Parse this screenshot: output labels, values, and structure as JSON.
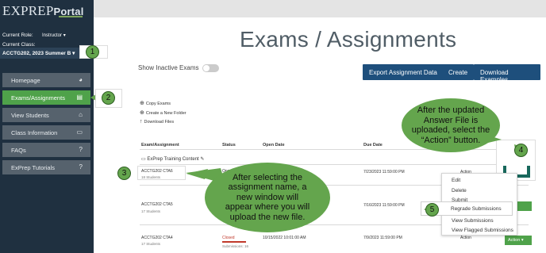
{
  "app": {
    "logo_main": "EXPREP",
    "logo_portal": "Portal"
  },
  "sidebar": {
    "role_label": "Current Role:",
    "role_value": "Instructor",
    "class_label": "Current Class:",
    "class_value": "ACCTG202, 2023 Summer B",
    "items": [
      {
        "label": "Homepage",
        "icon": "dashboard-icon"
      },
      {
        "label": "Exams/Assignments",
        "icon": "document-icon"
      },
      {
        "label": "View Students",
        "icon": "building-icon"
      },
      {
        "label": "Class Information",
        "icon": "folder-icon"
      },
      {
        "label": "FAQs",
        "icon": "question-icon"
      },
      {
        "label": "ExPrep Tutorials",
        "icon": "question-icon"
      }
    ]
  },
  "main": {
    "title": "Exams / Assignments",
    "toggle_label": "Show Inactive Exams",
    "buttons": [
      "Export Assignment Data",
      "Create",
      "Download Examples"
    ],
    "links": [
      "Copy Exams",
      "Create a New Folder",
      "Download Files"
    ],
    "columns": [
      "Exam/Assignment",
      "Status",
      "Open Date",
      "Due Date"
    ],
    "folder": "ExPrep Training Content",
    "rows": [
      {
        "name": "ACCTG202 CTA6",
        "students": "18 Students",
        "status": "Open",
        "open": "",
        "due": "7/23/2023 11:59:00 PM",
        "action": "Action"
      },
      {
        "name": "ACCTG202 CTA5",
        "students": "17 Students",
        "status": "",
        "open": "",
        "due": "7/16/2023 11:59:00 PM",
        "action": "Action"
      },
      {
        "name": "ACCTG202 CTA4",
        "students": "17 Students",
        "status": "Closed",
        "submissions": "Submissions: 16",
        "open": "10/15/2022 10:01:00 AM",
        "due": "7/9/2023 11:59:00 PM",
        "action": "Action"
      }
    ],
    "menu": [
      "Edit",
      "Delete",
      "Submit",
      "Regrade Submissions",
      "View Submissions",
      "View Flagged Submissions"
    ]
  },
  "callouts": {
    "c1": "1",
    "c2": "2",
    "c3": "3",
    "c4": "4",
    "c5": "5",
    "bubble_right": "After the updated Answer File is uploaded, select the “Action” button.",
    "bubble_left": "After selecting the assignment name, a new window will appear where you will upload the new file."
  },
  "colors": {
    "sidebar": "#1f3040",
    "active": "#4fa24a",
    "button": "#1e4f7c",
    "callout": "#64a54d"
  }
}
